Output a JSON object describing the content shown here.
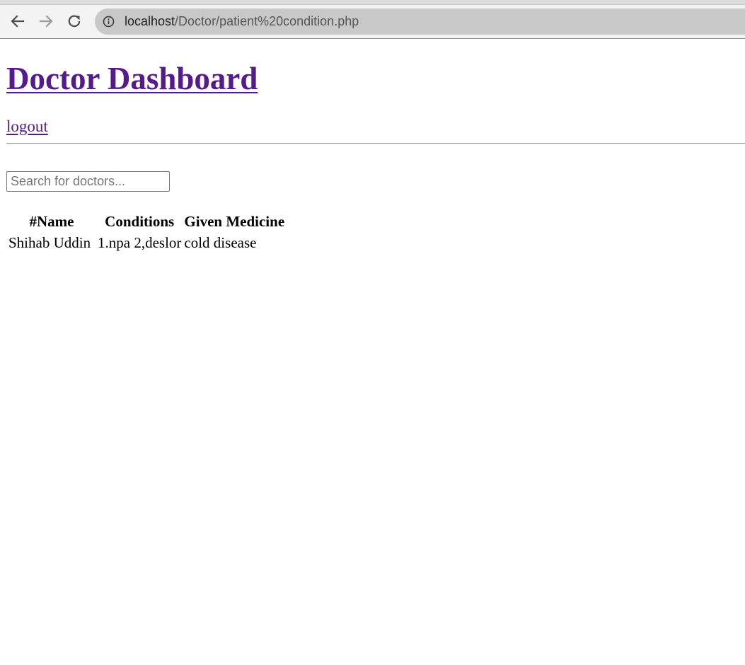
{
  "browser": {
    "url_host": "localhost",
    "url_path": "/Doctor/patient%20condition.php",
    "icons": {
      "back": "arrow-left-icon",
      "forward": "arrow-right-icon",
      "reload": "reload-icon",
      "site_info": "info-icon"
    }
  },
  "page": {
    "title": "Doctor Dashboard",
    "logout_label": "logout",
    "search": {
      "placeholder": "Search for doctors...",
      "value": ""
    },
    "table": {
      "headers": {
        "name": "#Name",
        "conditions": "Conditions",
        "medicine": "Given Medicine"
      },
      "rows": [
        {
          "name": "Shihab Uddin",
          "conditions": "1.npa 2,deslor",
          "medicine": "cold disease"
        }
      ]
    }
  },
  "colors": {
    "visited_link": "#551a8b",
    "address_bar": "#c8c8c8",
    "browser_chrome": "#f3f3f3"
  }
}
